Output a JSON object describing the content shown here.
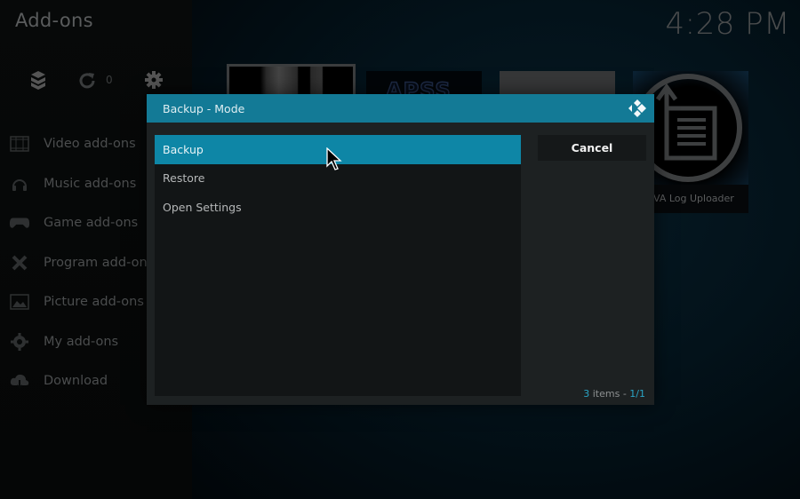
{
  "app": {
    "title": "Add-ons",
    "clock": "4:28 PM"
  },
  "toolbar": {
    "icons": [
      {
        "name": "addon-box-icon"
      },
      {
        "name": "refresh-icon",
        "count": "0"
      },
      {
        "name": "gear-icon"
      }
    ]
  },
  "sidebar": {
    "items": [
      {
        "label": "Video add-ons",
        "icon": "film-icon"
      },
      {
        "label": "Music add-ons",
        "icon": "headphones-icon"
      },
      {
        "label": "Game add-ons",
        "icon": "gamepad-icon"
      },
      {
        "label": "Program add-ons",
        "icon": "tools-icon"
      },
      {
        "label": "Picture add-ons",
        "icon": "picture-icon"
      },
      {
        "label": "My add-ons",
        "icon": "settings-tools-icon"
      },
      {
        "label": "Download",
        "icon": "cloud-download-icon"
      }
    ]
  },
  "background_thumbs": {
    "thumb2_text": "APSS",
    "thumb4_label": "VA Log Uploader"
  },
  "dialog": {
    "title": "Backup - Mode",
    "items": [
      {
        "label": "Backup",
        "selected": true
      },
      {
        "label": "Restore",
        "selected": false
      },
      {
        "label": "Open Settings",
        "selected": false
      }
    ],
    "cancel_label": "Cancel",
    "footer": {
      "count": "3",
      "items_word": " items - ",
      "page": "1/1"
    }
  },
  "colors": {
    "accent": "#0e86a6",
    "header": "#137a96",
    "dialog_bg": "#1d2122",
    "list_bg": "#121516"
  }
}
